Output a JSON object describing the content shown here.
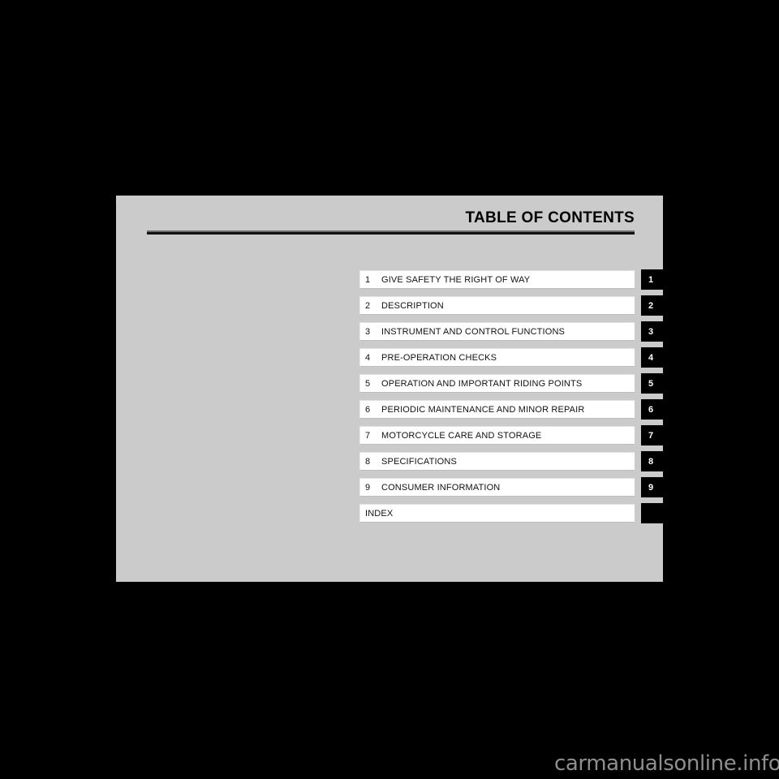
{
  "page": {
    "background_color": "#000000",
    "panel_color": "#cbcbcb"
  },
  "header": {
    "title": "TABLE OF CONTENTS"
  },
  "toc": {
    "rows": [
      {
        "number": "1",
        "label": "GIVE SAFETY THE RIGHT OF WAY",
        "tab": "1"
      },
      {
        "number": "2",
        "label": "DESCRIPTION",
        "tab": "2"
      },
      {
        "number": "3",
        "label": "INSTRUMENT AND CONTROL FUNCTIONS",
        "tab": "3"
      },
      {
        "number": "4",
        "label": "PRE-OPERATION CHECKS",
        "tab": "4"
      },
      {
        "number": "5",
        "label": "OPERATION AND IMPORTANT RIDING POINTS",
        "tab": "5"
      },
      {
        "number": "6",
        "label": "PERIODIC MAINTENANCE AND MINOR REPAIR",
        "tab": "6"
      },
      {
        "number": "7",
        "label": "MOTORCYCLE CARE AND STORAGE",
        "tab": "7"
      },
      {
        "number": "8",
        "label": "SPECIFICATIONS",
        "tab": "8"
      },
      {
        "number": "9",
        "label": "CONSUMER INFORMATION",
        "tab": "9"
      },
      {
        "number": "",
        "label": "INDEX",
        "tab": ""
      }
    ]
  },
  "watermark": {
    "text": "carmanualsonline.info",
    "color": "#8f8f8f"
  }
}
